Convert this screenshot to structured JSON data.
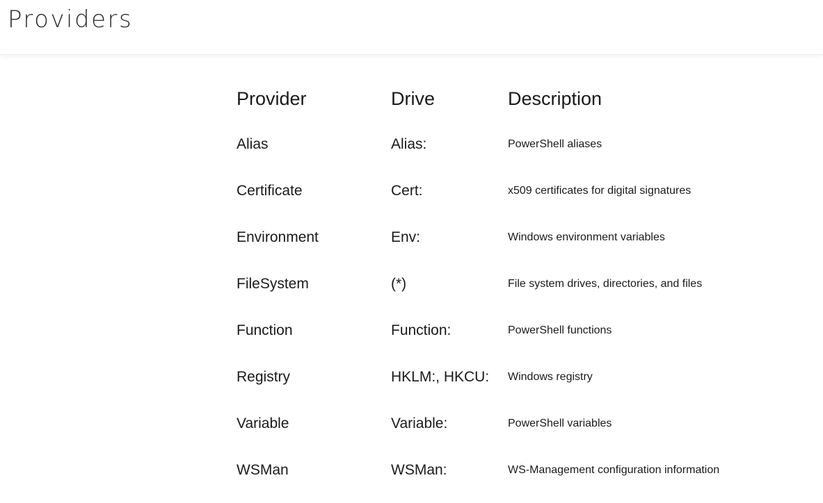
{
  "slide": {
    "title": "Providers"
  },
  "table": {
    "headers": {
      "provider": "Provider",
      "drive": "Drive",
      "description": "Description"
    },
    "rows": [
      {
        "provider": "Alias",
        "drive": "Alias:",
        "description": "PowerShell aliases"
      },
      {
        "provider": "Certificate",
        "drive": "Cert:",
        "description": "x509 certificates for digital signatures"
      },
      {
        "provider": "Environment",
        "drive": "Env:",
        "description": "Windows environment variables"
      },
      {
        "provider": "FileSystem",
        "drive": "(*)",
        "description": "File system drives, directories, and files"
      },
      {
        "provider": "Function",
        "drive": "Function:",
        "description": "PowerShell functions"
      },
      {
        "provider": "Registry",
        "drive": "HKLM:, HKCU:",
        "description": "Windows registry"
      },
      {
        "provider": "Variable",
        "drive": "Variable:",
        "description": "PowerShell variables"
      },
      {
        "provider": "WSMan",
        "drive": "WSMan:",
        "description": "WS-Management configuration information"
      }
    ]
  }
}
